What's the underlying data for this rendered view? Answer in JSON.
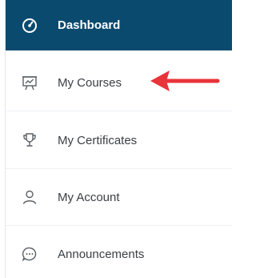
{
  "nav": {
    "items": [
      {
        "label": "Dashboard",
        "icon": "dashboard-gauge-icon",
        "active": true
      },
      {
        "label": "My Courses",
        "icon": "presentation-board-icon",
        "active": false
      },
      {
        "label": "My Certificates",
        "icon": "trophy-icon",
        "active": false
      },
      {
        "label": "My Account",
        "icon": "user-icon",
        "active": false
      },
      {
        "label": "Announcements",
        "icon": "chat-bubble-icon",
        "active": false
      }
    ]
  },
  "annotation": {
    "arrow_color": "#e8343a",
    "points_to": "My Courses"
  },
  "colors": {
    "active_bg": "#0b4a6f",
    "text": "#3a3f44",
    "active_text": "#ffffff"
  }
}
